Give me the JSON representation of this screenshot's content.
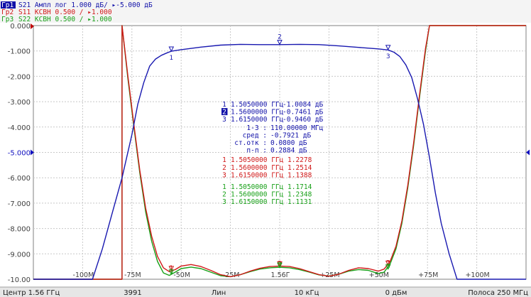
{
  "header": {
    "traces": [
      {
        "id": "Гр1",
        "text": "S21 Ампл лог 1.000 дБ/ ▸-5.000 дБ",
        "color": "#1010a8",
        "active": true
      },
      {
        "id": "Гр2",
        "text": "S11 КСВН 0.500 / ▸1.000",
        "color": "#d01818",
        "active": false
      },
      {
        "id": "Гр3",
        "text": "S22 КСВН 0.500 / ▸1.000",
        "color": "#18a018",
        "active": false
      }
    ]
  },
  "status_bar": {
    "center": "Центр 1.56 ГГц",
    "points": "3991",
    "sweep": "Лин",
    "ifbw": "10 кГц",
    "power": "0 дБм",
    "span": "Полоса 250 МГц"
  },
  "markers_table": {
    "s21": [
      {
        "n": "1",
        "freq": "1.5050000 ГГц",
        "value": "-1.0084 дБ",
        "active": false
      },
      {
        "n": "2",
        "freq": "1.5600000 ГГц",
        "value": "-0.7461 дБ",
        "active": true
      },
      {
        "n": "3",
        "freq": "1.6150000 ГГц",
        "value": "-0.9460 дБ",
        "active": false
      }
    ],
    "stats": [
      {
        "label": "1-3 :",
        "value": "110.00000 МГц"
      },
      {
        "label": "сред :",
        "value": "-0.7921 дБ"
      },
      {
        "label": "ст.отк :",
        "value": "0.0800 дБ"
      },
      {
        "label": "п-п :",
        "value": "0.2884 дБ"
      }
    ],
    "s11": [
      {
        "n": "1",
        "freq": "1.5050000 ГГц",
        "value": "1.2278"
      },
      {
        "n": "2",
        "freq": "1.5600000 ГГц",
        "value": "1.2514"
      },
      {
        "n": "3",
        "freq": "1.6150000 ГГц",
        "value": "1.1388"
      }
    ],
    "s22": [
      {
        "n": "1",
        "freq": "1.5050000 ГГц",
        "value": "1.1714"
      },
      {
        "n": "2",
        "freq": "1.5600000 ГГц",
        "value": "1.2348"
      },
      {
        "n": "3",
        "freq": "1.6150000 ГГц",
        "value": "1.1131"
      }
    ]
  },
  "chart_data": {
    "type": "line",
    "x_unit": "MHz offset from center",
    "xlim": [
      -125,
      125
    ],
    "ylim": [
      -10,
      0
    ],
    "y_tick_labels": [
      "0.000",
      "-1.000",
      "-2.000",
      "-3.000",
      "-4.000",
      "-5.000",
      "-6.000",
      "-7.000",
      "-8.000",
      "-9.000",
      "-10.00"
    ],
    "reference_tick": "-5.000",
    "x_ticks": [
      {
        "x": -100,
        "label": "-100M"
      },
      {
        "x": -75,
        "label": "-75M"
      },
      {
        "x": -50,
        "label": "-50M"
      },
      {
        "x": -25,
        "label": "-25M"
      },
      {
        "x": 0,
        "label": "1.56Г"
      },
      {
        "x": 25,
        "label": "+25M"
      },
      {
        "x": 50,
        "label": "+50M"
      },
      {
        "x": 75,
        "label": "+75M"
      },
      {
        "x": 100,
        "label": "+100M"
      }
    ],
    "grid": true,
    "series": [
      {
        "name": "S21",
        "color": "#1818b0",
        "points": [
          [
            -125,
            -10.0
          ],
          [
            -95,
            -10.0
          ],
          [
            -90,
            -8.8
          ],
          [
            -85,
            -7.4
          ],
          [
            -80,
            -6.0
          ],
          [
            -75,
            -4.3
          ],
          [
            -72,
            -3.1
          ],
          [
            -69,
            -2.25
          ],
          [
            -66,
            -1.6
          ],
          [
            -63,
            -1.32
          ],
          [
            -60,
            -1.17
          ],
          [
            -57,
            -1.07
          ],
          [
            -55,
            -1.01
          ],
          [
            -50,
            -0.95
          ],
          [
            -40,
            -0.85
          ],
          [
            -30,
            -0.77
          ],
          [
            -20,
            -0.74
          ],
          [
            -10,
            -0.75
          ],
          [
            0,
            -0.75
          ],
          [
            10,
            -0.74
          ],
          [
            20,
            -0.75
          ],
          [
            30,
            -0.8
          ],
          [
            40,
            -0.86
          ],
          [
            50,
            -0.92
          ],
          [
            55,
            -0.96
          ],
          [
            58,
            -1.05
          ],
          [
            61,
            -1.22
          ],
          [
            64,
            -1.55
          ],
          [
            67,
            -2.05
          ],
          [
            70,
            -2.9
          ],
          [
            73,
            -3.9
          ],
          [
            76,
            -5.2
          ],
          [
            79,
            -6.6
          ],
          [
            82,
            -7.8
          ],
          [
            86,
            -9.0
          ],
          [
            90,
            -10.0
          ],
          [
            125,
            -10.0
          ]
        ]
      },
      {
        "name": "S11",
        "color": "#d01818",
        "points": [
          [
            -125,
            -10.0
          ],
          [
            -80,
            -10.0
          ],
          [
            -80,
            0.0
          ],
          [
            -77,
            -2.0
          ],
          [
            -74,
            -3.9
          ],
          [
            -71,
            -5.7
          ],
          [
            -68,
            -7.2
          ],
          [
            -65,
            -8.3
          ],
          [
            -62,
            -9.1
          ],
          [
            -59,
            -9.55
          ],
          [
            -56,
            -9.7
          ],
          [
            -53,
            -9.62
          ],
          [
            -50,
            -9.48
          ],
          [
            -45,
            -9.42
          ],
          [
            -40,
            -9.5
          ],
          [
            -35,
            -9.65
          ],
          [
            -30,
            -9.82
          ],
          [
            -25,
            -9.9
          ],
          [
            -20,
            -9.82
          ],
          [
            -15,
            -9.68
          ],
          [
            -10,
            -9.57
          ],
          [
            -5,
            -9.5
          ],
          [
            0,
            -9.48
          ],
          [
            5,
            -9.5
          ],
          [
            10,
            -9.58
          ],
          [
            15,
            -9.7
          ],
          [
            20,
            -9.82
          ],
          [
            25,
            -9.88
          ],
          [
            30,
            -9.8
          ],
          [
            35,
            -9.65
          ],
          [
            40,
            -9.55
          ],
          [
            45,
            -9.58
          ],
          [
            50,
            -9.68
          ],
          [
            53,
            -9.6
          ],
          [
            56,
            -9.3
          ],
          [
            59,
            -8.7
          ],
          [
            62,
            -7.7
          ],
          [
            65,
            -6.3
          ],
          [
            68,
            -4.6
          ],
          [
            71,
            -2.7
          ],
          [
            74,
            -0.9
          ],
          [
            76,
            0.0
          ],
          [
            125,
            0.0
          ]
        ]
      },
      {
        "name": "S22",
        "color": "#18a018",
        "points": [
          [
            -125,
            -10.0
          ],
          [
            -80,
            -10.0
          ],
          [
            -80,
            0.0
          ],
          [
            -77,
            -2.1
          ],
          [
            -74,
            -4.0
          ],
          [
            -71,
            -5.8
          ],
          [
            -68,
            -7.35
          ],
          [
            -65,
            -8.5
          ],
          [
            -62,
            -9.3
          ],
          [
            -59,
            -9.75
          ],
          [
            -56,
            -9.85
          ],
          [
            -53,
            -9.72
          ],
          [
            -50,
            -9.58
          ],
          [
            -45,
            -9.52
          ],
          [
            -40,
            -9.58
          ],
          [
            -35,
            -9.72
          ],
          [
            -30,
            -9.86
          ],
          [
            -25,
            -9.9
          ],
          [
            -20,
            -9.82
          ],
          [
            -15,
            -9.7
          ],
          [
            -10,
            -9.6
          ],
          [
            -5,
            -9.55
          ],
          [
            0,
            -9.53
          ],
          [
            5,
            -9.55
          ],
          [
            10,
            -9.62
          ],
          [
            15,
            -9.72
          ],
          [
            20,
            -9.83
          ],
          [
            25,
            -9.87
          ],
          [
            30,
            -9.8
          ],
          [
            35,
            -9.68
          ],
          [
            40,
            -9.62
          ],
          [
            45,
            -9.65
          ],
          [
            50,
            -9.78
          ],
          [
            53,
            -9.72
          ],
          [
            56,
            -9.4
          ],
          [
            59,
            -8.8
          ],
          [
            62,
            -7.8
          ],
          [
            65,
            -6.4
          ],
          [
            68,
            -4.7
          ],
          [
            71,
            -2.8
          ],
          [
            74,
            -1.0
          ],
          [
            76,
            0.0
          ],
          [
            125,
            0.0
          ]
        ]
      }
    ],
    "markers": [
      {
        "series": "S21",
        "n": "1",
        "x": -55,
        "y": -1.0084
      },
      {
        "series": "S21",
        "n": "2",
        "x": 0,
        "y": -0.7461
      },
      {
        "series": "S21",
        "n": "3",
        "x": 55,
        "y": -0.946
      },
      {
        "series": "S11",
        "n": "1",
        "x": -55,
        "y": -9.66
      },
      {
        "series": "S11",
        "n": "2",
        "x": 0,
        "y": -9.48
      },
      {
        "series": "S11",
        "n": "3",
        "x": 55,
        "y": -9.45
      },
      {
        "series": "S22",
        "n": "1",
        "x": -55,
        "y": -9.8
      },
      {
        "series": "S22",
        "n": "2",
        "x": 0,
        "y": -9.53
      },
      {
        "series": "S22",
        "n": "3",
        "x": 55,
        "y": -9.6
      }
    ]
  }
}
